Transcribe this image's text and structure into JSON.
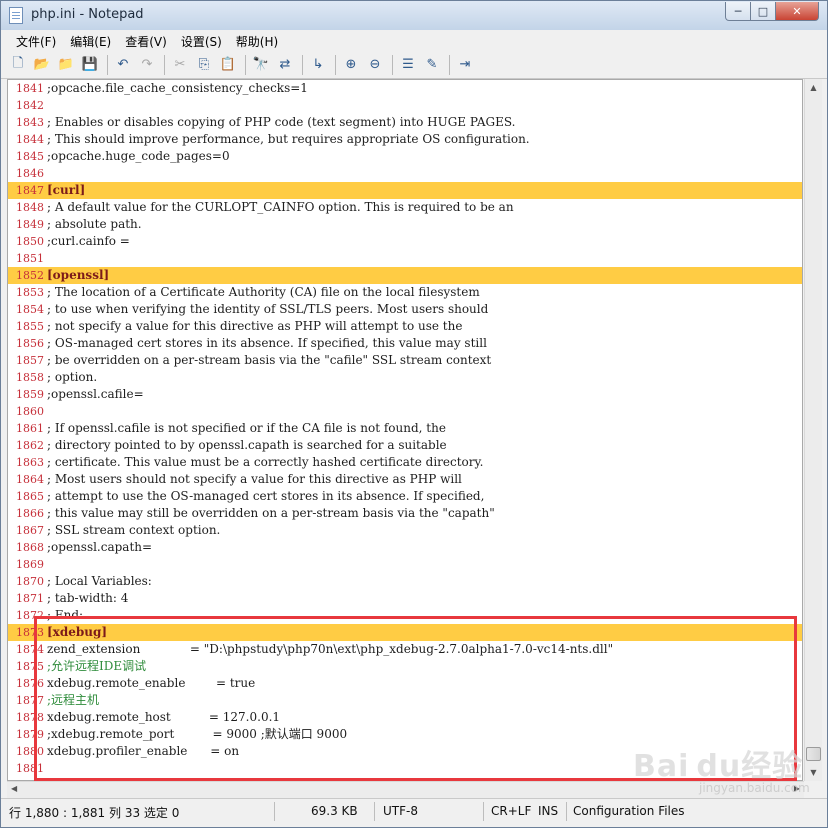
{
  "window": {
    "title": "php.ini - Notepad",
    "min": "─",
    "max": "□",
    "close": "✕"
  },
  "menu": [
    "文件(F)",
    "编辑(E)",
    "查看(V)",
    "设置(S)",
    "帮助(H)"
  ],
  "toolbar": [
    {
      "icon": "new-file-icon",
      "glyph": "🗋"
    },
    {
      "icon": "open-icon",
      "glyph": "📂"
    },
    {
      "icon": "open-folder-icon",
      "glyph": "📁"
    },
    {
      "icon": "save-icon",
      "glyph": "💾"
    },
    {
      "sep": true
    },
    {
      "icon": "undo-icon",
      "glyph": "↶"
    },
    {
      "icon": "redo-icon",
      "glyph": "↷",
      "disabled": true
    },
    {
      "sep": true
    },
    {
      "icon": "cut-icon",
      "glyph": "✂",
      "disabled": true
    },
    {
      "icon": "copy-icon",
      "glyph": "⎘"
    },
    {
      "icon": "paste-icon",
      "glyph": "📋"
    },
    {
      "sep": true
    },
    {
      "icon": "find-icon",
      "glyph": "🔭"
    },
    {
      "icon": "replace-icon",
      "glyph": "⇄"
    },
    {
      "sep": true
    },
    {
      "icon": "goto-icon",
      "glyph": "↳"
    },
    {
      "sep": true
    },
    {
      "icon": "zoom-in-icon",
      "glyph": "⊕"
    },
    {
      "icon": "zoom-out-icon",
      "glyph": "⊖"
    },
    {
      "sep": true
    },
    {
      "icon": "options-icon",
      "glyph": "☰"
    },
    {
      "icon": "scheme-icon",
      "glyph": "✎"
    },
    {
      "sep": true
    },
    {
      "icon": "exit-icon",
      "glyph": "⇥"
    }
  ],
  "editor": {
    "lines": [
      {
        "n": "1841",
        "t": ";opcache.file_cache_consistency_checks=1",
        "k": "plain"
      },
      {
        "n": "1842",
        "t": "",
        "k": "plain"
      },
      {
        "n": "1843",
        "t": "; Enables or disables copying of PHP code (text segment) into HUGE PAGES.",
        "k": "plain"
      },
      {
        "n": "1844",
        "t": "; This should improve performance, but requires appropriate OS configuration.",
        "k": "plain"
      },
      {
        "n": "1845",
        "t": ";opcache.huge_code_pages=0",
        "k": "plain"
      },
      {
        "n": "1846",
        "t": "",
        "k": "plain"
      },
      {
        "n": "1847",
        "t": "[curl]",
        "k": "section"
      },
      {
        "n": "1848",
        "t": "; A default value for the CURLOPT_CAINFO option. This is required to be an",
        "k": "plain"
      },
      {
        "n": "1849",
        "t": "; absolute path.",
        "k": "plain"
      },
      {
        "n": "1850",
        "t": ";curl.cainfo =",
        "k": "plain"
      },
      {
        "n": "1851",
        "t": "",
        "k": "plain"
      },
      {
        "n": "1852",
        "t": "[openssl]",
        "k": "section"
      },
      {
        "n": "1853",
        "t": "; The location of a Certificate Authority (CA) file on the local filesystem",
        "k": "plain"
      },
      {
        "n": "1854",
        "t": "; to use when verifying the identity of SSL/TLS peers. Most users should",
        "k": "plain"
      },
      {
        "n": "1855",
        "t": "; not specify a value for this directive as PHP will attempt to use the",
        "k": "plain"
      },
      {
        "n": "1856",
        "t": "; OS-managed cert stores in its absence. If specified, this value may still",
        "k": "plain"
      },
      {
        "n": "1857",
        "t": "; be overridden on a per-stream basis via the \"cafile\" SSL stream context",
        "k": "plain"
      },
      {
        "n": "1858",
        "t": "; option.",
        "k": "plain"
      },
      {
        "n": "1859",
        "t": ";openssl.cafile=",
        "k": "plain"
      },
      {
        "n": "1860",
        "t": "",
        "k": "plain"
      },
      {
        "n": "1861",
        "t": "; If openssl.cafile is not specified or if the CA file is not found, the",
        "k": "plain"
      },
      {
        "n": "1862",
        "t": "; directory pointed to by openssl.capath is searched for a suitable",
        "k": "plain"
      },
      {
        "n": "1863",
        "t": "; certificate. This value must be a correctly hashed certificate directory.",
        "k": "plain"
      },
      {
        "n": "1864",
        "t": "; Most users should not specify a value for this directive as PHP will",
        "k": "plain"
      },
      {
        "n": "1865",
        "t": "; attempt to use the OS-managed cert stores in its absence. If specified,",
        "k": "plain"
      },
      {
        "n": "1866",
        "t": "; this value may still be overridden on a per-stream basis via the \"capath\"",
        "k": "plain"
      },
      {
        "n": "1867",
        "t": "; SSL stream context option.",
        "k": "plain"
      },
      {
        "n": "1868",
        "t": ";openssl.capath=",
        "k": "plain"
      },
      {
        "n": "1869",
        "t": "",
        "k": "plain"
      },
      {
        "n": "1870",
        "t": "; Local Variables:",
        "k": "plain"
      },
      {
        "n": "1871",
        "t": "; tab-width: 4",
        "k": "plain"
      },
      {
        "n": "1872",
        "t": "; End:",
        "k": "plain"
      },
      {
        "n": "1873",
        "t": "[xdebug]",
        "k": "section"
      },
      {
        "n": "1874",
        "t": "zend_extension             = \"D:\\phpstudy\\php70n\\ext\\php_xdebug-2.7.0alpha1-7.0-vc14-nts.dll\"",
        "k": "plain"
      },
      {
        "n": "1875",
        "t": ";允许远程IDE调试",
        "k": "comment"
      },
      {
        "n": "1876",
        "t": "xdebug.remote_enable        = true",
        "k": "plain"
      },
      {
        "n": "1877",
        "t": ";远程主机",
        "k": "comment"
      },
      {
        "n": "1878",
        "t": "xdebug.remote_host          = 127.0.0.1",
        "k": "plain"
      },
      {
        "n": "1879",
        "t": ";xdebug.remote_port          = 9000 ;默认端口 9000",
        "k": "plain"
      },
      {
        "n": "1880",
        "t": "xdebug.profiler_enable      = on",
        "k": "plain"
      },
      {
        "n": "1881",
        "t": "",
        "k": "plain"
      }
    ]
  },
  "status": {
    "position": "行 1,880 : 1,881   列 33   选定 0",
    "size": "69.3 KB",
    "encoding": "UTF-8",
    "eol": "CR+LF",
    "mode": "INS",
    "scheme": "Configuration Files"
  },
  "watermark": {
    "text": "Bai du经验",
    "sub": "jingyan.baidu.com"
  },
  "colors": {
    "highlight": "#ffcc44",
    "annotation": "#e8383d",
    "line_numbers": "#c6303a"
  }
}
